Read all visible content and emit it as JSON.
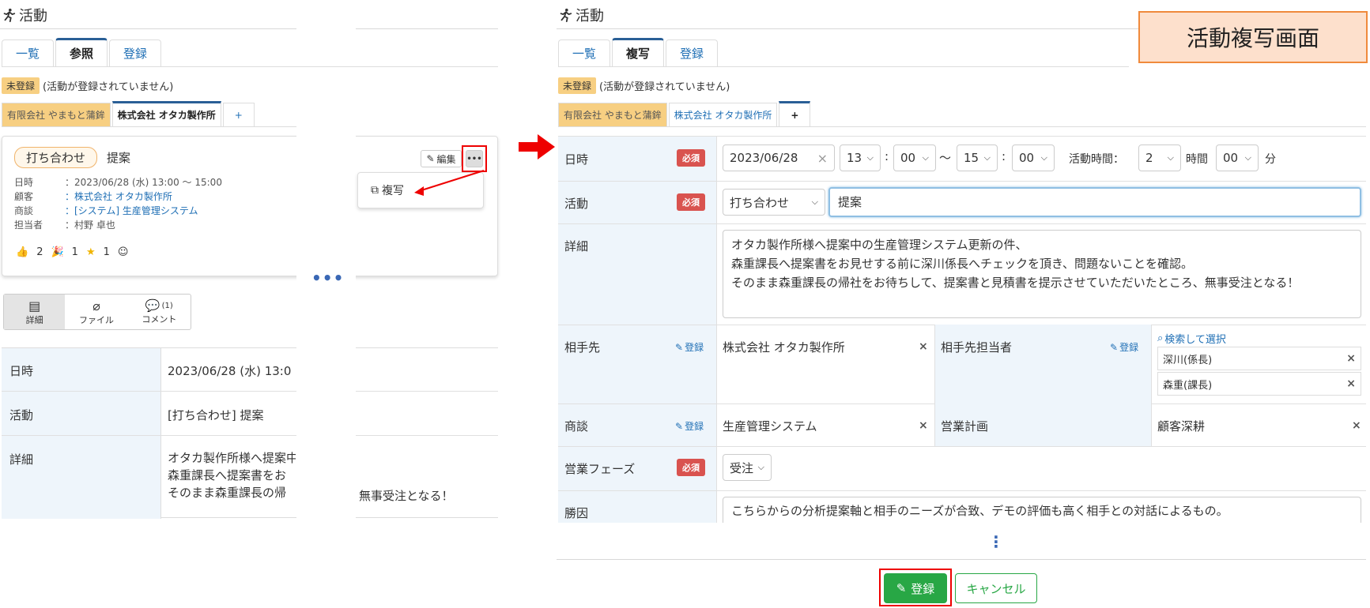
{
  "left": {
    "title": "活動",
    "tabs": [
      "一覧",
      "参照",
      "登録"
    ],
    "status_badge": "未登録",
    "status_note": "(活動が登録されていません)",
    "customer_tabs": [
      "有限会社 やまもと蒲鉾",
      "株式会社 オタカ製作所",
      "+"
    ],
    "card": {
      "pill": "打ち合わせ",
      "subject": "提案",
      "edit_label": "編集",
      "more_label": "•••",
      "rows": [
        {
          "k": "日時",
          "v": "：2023/06/28 (水) 13:00 ～ 15:00"
        },
        {
          "k": "顧客",
          "v": "：株式会社 オタカ製作所"
        },
        {
          "k": "商談",
          "v": "：[システム] 生産管理システム"
        },
        {
          "k": "担当者",
          "v": "：村野 卓也"
        }
      ],
      "reactions": [
        "2",
        "1",
        "1"
      ]
    },
    "popup_copy": "複写",
    "subtabs": [
      "詳細",
      "ファイル",
      "コメント"
    ],
    "comment_count": "(1)",
    "ellipsis": "•••",
    "table": [
      {
        "k": "日時",
        "v": "2023/06/28 (水) 13:0"
      },
      {
        "k": "活動",
        "v": "[打ち合わせ] 提案"
      },
      {
        "k": "詳細",
        "v": "オタカ製作所様へ提案中\n森重課長へ提案書をお\nそのまま森重課長の帰"
      }
    ],
    "table_tail": "無事受注となる！"
  },
  "right": {
    "title": "活動",
    "tabs": [
      "一覧",
      "複写",
      "登録"
    ],
    "status_badge": "未登録",
    "status_note": "(活動が登録されていません)",
    "customer_tabs": [
      "有限会社 やまもと蒲鉾",
      "株式会社 オタカ製作所",
      "+"
    ],
    "callout": "活動複写画面",
    "required": "必須",
    "register_link": "登録",
    "fields": {
      "datetime": {
        "label": "日時",
        "date": "2023/06/28",
        "h1": "13",
        "m1": "00",
        "tilde": "～",
        "h2": "15",
        "m2": "00",
        "colon": ":",
        "dur_label": "活動時間：",
        "dur_h": "2",
        "hour_unit": "時間",
        "dur_m": "00",
        "min_unit": "分"
      },
      "activity": {
        "label": "活動",
        "type": "打ち合わせ",
        "subject": "提案"
      },
      "detail": {
        "label": "詳細",
        "lines": [
          "オタカ製作所様へ提案中の生産管理システム更新の件、",
          "森重課長へ提案書をお見せする前に深川係長へチェックを頂き、問題ないことを確認。",
          "そのまま森重課長の帰社をお待ちして、提案書と見積書を提示させていただいたところ、無事受注となる！"
        ]
      },
      "partner": {
        "label": "相手先",
        "value": "株式会社 オタカ製作所",
        "contact_label": "相手先担当者",
        "search": "検索して選択",
        "contacts": [
          "深川(係長)",
          "森重(課長)"
        ]
      },
      "deal": {
        "label": "商談",
        "value": "生産管理システム",
        "plan_label": "営業計画",
        "plan_value": "顧客深耕"
      },
      "phase": {
        "label": "営業フェーズ",
        "value": "受注"
      },
      "win": {
        "label": "勝因",
        "value": "こちらからの分析提案軸と相手のニーズが合致、デモの評価も高く相手との対話によるもの。"
      }
    },
    "vmore": "⋮",
    "submit": "登録",
    "cancel": "キャンセル"
  },
  "colors": {
    "accent": "#1f6fb5",
    "required": "#d9534f",
    "highlight": "#f7cf82",
    "submit": "#28a745",
    "callout_bg": "#fde0cc",
    "callout_border": "#f08a3c",
    "red": "#e00000"
  }
}
